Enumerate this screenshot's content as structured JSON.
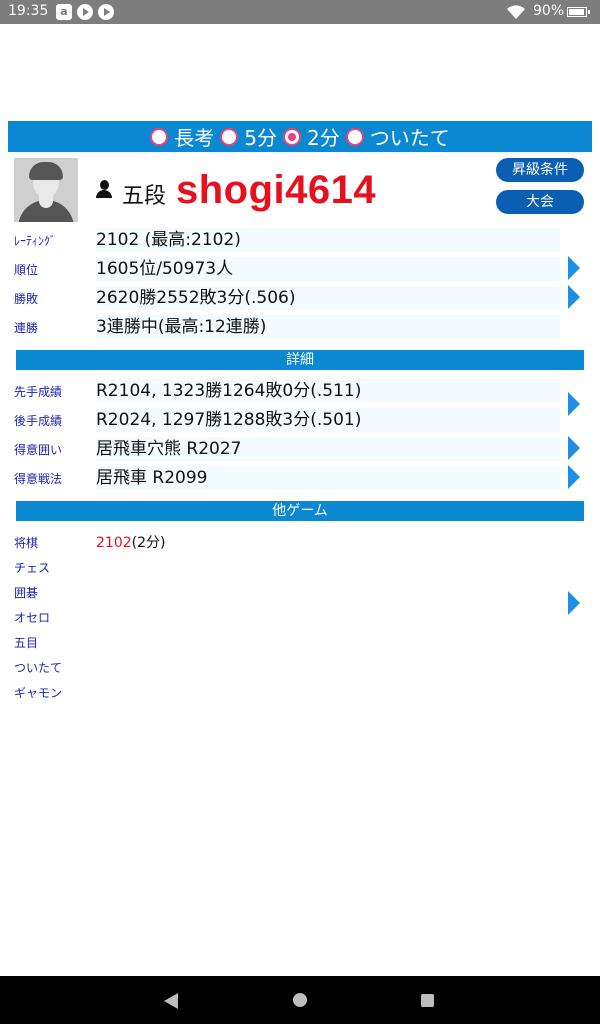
{
  "status_bar": {
    "time": "19:35",
    "battery": "90%",
    "app_icon_letter": "a"
  },
  "modes": [
    {
      "label": "長考",
      "selected": false
    },
    {
      "label": "5分",
      "selected": false
    },
    {
      "label": "2分",
      "selected": true
    },
    {
      "label": "ついたて",
      "selected": false
    }
  ],
  "profile": {
    "rank": "五段",
    "username": "shogi4614",
    "button_promotion": "昇級条件",
    "button_tournament": "大会"
  },
  "stats": [
    {
      "label": "ﾚｰﾃｨﾝｸﾞ",
      "value": "2102 (最高:2102)"
    },
    {
      "label": "順位",
      "value": "1605位/50973人"
    },
    {
      "label": "勝敗",
      "value": "2620勝2552敗3分(.506)"
    },
    {
      "label": "連勝",
      "value": "3連勝中(最高:12連勝)"
    }
  ],
  "details_header": "詳細",
  "details": [
    {
      "label": "先手成績",
      "value": "R2104, 1323勝1264敗0分(.511)"
    },
    {
      "label": "後手成績",
      "value": "R2024, 1297勝1288敗3分(.501)"
    },
    {
      "label": "得意囲い",
      "value": "居飛車穴熊 R2027"
    },
    {
      "label": "得意戦法",
      "value": "居飛車 R2099"
    }
  ],
  "other_games_header": "他ゲーム",
  "other_games": [
    {
      "label": "将棋",
      "rating": "2102",
      "suffix": "(2分)"
    },
    {
      "label": "チェス",
      "rating": "",
      "suffix": ""
    },
    {
      "label": "囲碁",
      "rating": "",
      "suffix": ""
    },
    {
      "label": "オセロ",
      "rating": "",
      "suffix": ""
    },
    {
      "label": "五目",
      "rating": "",
      "suffix": ""
    },
    {
      "label": "ついたて",
      "rating": "",
      "suffix": ""
    },
    {
      "label": "ギャモン",
      "rating": "",
      "suffix": ""
    }
  ],
  "colors": {
    "accent": "#0a88d1",
    "username": "#e8101f",
    "label": "#1b25b3",
    "radio": "#e8417b"
  }
}
